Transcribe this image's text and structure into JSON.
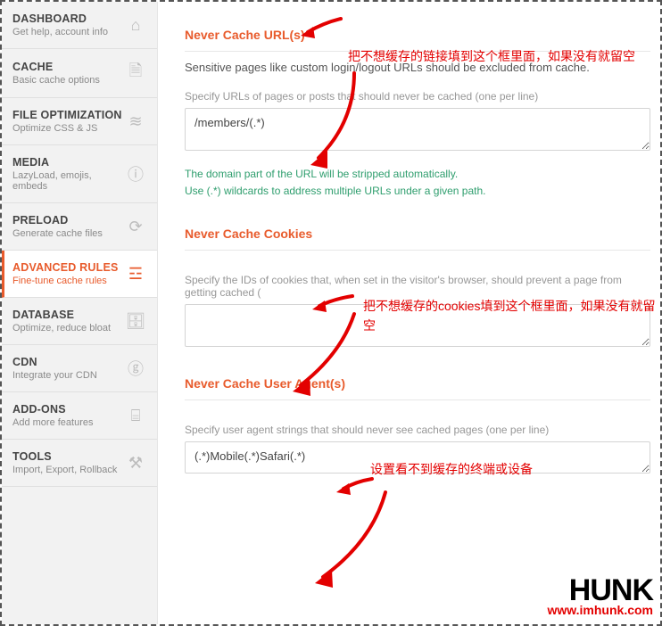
{
  "sidebar": {
    "items": [
      {
        "title": "DASHBOARD",
        "sub": "Get help, account info",
        "icon": "⌂"
      },
      {
        "title": "CACHE",
        "sub": "Basic cache options",
        "icon": "🗎"
      },
      {
        "title": "FILE OPTIMIZATION",
        "sub": "Optimize CSS & JS",
        "icon": "≋"
      },
      {
        "title": "MEDIA",
        "sub": "LazyLoad, emojis, embeds",
        "icon": "ⓘ"
      },
      {
        "title": "PRELOAD",
        "sub": "Generate cache files",
        "icon": "⟳"
      },
      {
        "title": "ADVANCED RULES",
        "sub": "Fine-tune cache rules",
        "icon": "☲"
      },
      {
        "title": "DATABASE",
        "sub": "Optimize, reduce bloat",
        "icon": "🗄"
      },
      {
        "title": "CDN",
        "sub": "Integrate your CDN",
        "icon": "ⓖ"
      },
      {
        "title": "ADD-ONS",
        "sub": "Add more features",
        "icon": "⌸"
      },
      {
        "title": "TOOLS",
        "sub": "Import, Export, Rollback",
        "icon": "⚒"
      }
    ]
  },
  "sections": {
    "urls": {
      "title": "Never Cache URL(s)",
      "desc": "Sensitive pages like custom login/logout URLs should be excluded from cache.",
      "label": "Specify URLs of pages or posts that should never be cached (one per line)",
      "value": "/members/(.*)",
      "hint1": "The domain part of the URL will be stripped automatically.",
      "hint2": "Use (.*) wildcards to address multiple URLs under a given path."
    },
    "cookies": {
      "title": "Never Cache Cookies",
      "label": "Specify the IDs of cookies that, when set in the visitor's browser, should prevent a page from getting cached (",
      "value": ""
    },
    "ua": {
      "title": "Never Cache User Agent(s)",
      "label": "Specify user agent strings that should never see cached pages (one per line)",
      "value": "(.*)Mobile(.*)Safari(.*)"
    }
  },
  "annotations": {
    "a1": "把不想缓存的链接填到这个框里面，如果没有就留空",
    "a2": "把不想缓存的cookies填到这个框里面，如果没有就留空",
    "a3": "设置看不到缓存的终端或设备"
  },
  "watermark": {
    "brand": "HUNK",
    "url": "www.imhunk.com"
  }
}
